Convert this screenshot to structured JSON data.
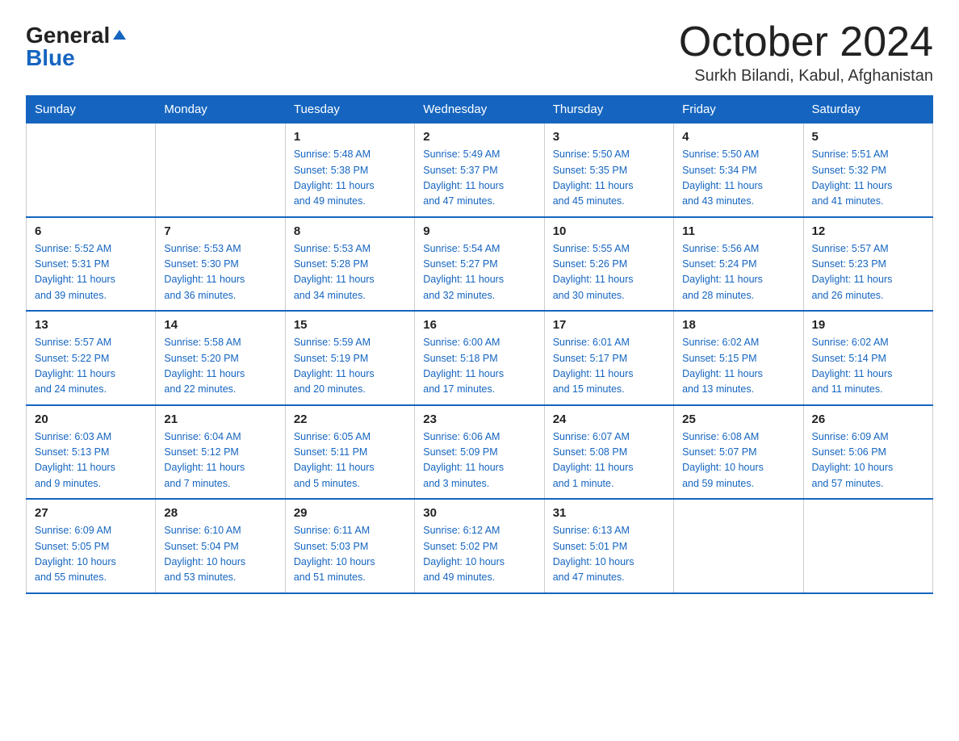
{
  "logo": {
    "line1": "General",
    "triangle": "▲",
    "line2": "Blue"
  },
  "title": "October 2024",
  "subtitle": "Surkh Bilandi, Kabul, Afghanistan",
  "days_of_week": [
    "Sunday",
    "Monday",
    "Tuesday",
    "Wednesday",
    "Thursday",
    "Friday",
    "Saturday"
  ],
  "weeks": [
    [
      {
        "day": "",
        "info": ""
      },
      {
        "day": "",
        "info": ""
      },
      {
        "day": "1",
        "info": "Sunrise: 5:48 AM\nSunset: 5:38 PM\nDaylight: 11 hours\nand 49 minutes."
      },
      {
        "day": "2",
        "info": "Sunrise: 5:49 AM\nSunset: 5:37 PM\nDaylight: 11 hours\nand 47 minutes."
      },
      {
        "day": "3",
        "info": "Sunrise: 5:50 AM\nSunset: 5:35 PM\nDaylight: 11 hours\nand 45 minutes."
      },
      {
        "day": "4",
        "info": "Sunrise: 5:50 AM\nSunset: 5:34 PM\nDaylight: 11 hours\nand 43 minutes."
      },
      {
        "day": "5",
        "info": "Sunrise: 5:51 AM\nSunset: 5:32 PM\nDaylight: 11 hours\nand 41 minutes."
      }
    ],
    [
      {
        "day": "6",
        "info": "Sunrise: 5:52 AM\nSunset: 5:31 PM\nDaylight: 11 hours\nand 39 minutes."
      },
      {
        "day": "7",
        "info": "Sunrise: 5:53 AM\nSunset: 5:30 PM\nDaylight: 11 hours\nand 36 minutes."
      },
      {
        "day": "8",
        "info": "Sunrise: 5:53 AM\nSunset: 5:28 PM\nDaylight: 11 hours\nand 34 minutes."
      },
      {
        "day": "9",
        "info": "Sunrise: 5:54 AM\nSunset: 5:27 PM\nDaylight: 11 hours\nand 32 minutes."
      },
      {
        "day": "10",
        "info": "Sunrise: 5:55 AM\nSunset: 5:26 PM\nDaylight: 11 hours\nand 30 minutes."
      },
      {
        "day": "11",
        "info": "Sunrise: 5:56 AM\nSunset: 5:24 PM\nDaylight: 11 hours\nand 28 minutes."
      },
      {
        "day": "12",
        "info": "Sunrise: 5:57 AM\nSunset: 5:23 PM\nDaylight: 11 hours\nand 26 minutes."
      }
    ],
    [
      {
        "day": "13",
        "info": "Sunrise: 5:57 AM\nSunset: 5:22 PM\nDaylight: 11 hours\nand 24 minutes."
      },
      {
        "day": "14",
        "info": "Sunrise: 5:58 AM\nSunset: 5:20 PM\nDaylight: 11 hours\nand 22 minutes."
      },
      {
        "day": "15",
        "info": "Sunrise: 5:59 AM\nSunset: 5:19 PM\nDaylight: 11 hours\nand 20 minutes."
      },
      {
        "day": "16",
        "info": "Sunrise: 6:00 AM\nSunset: 5:18 PM\nDaylight: 11 hours\nand 17 minutes."
      },
      {
        "day": "17",
        "info": "Sunrise: 6:01 AM\nSunset: 5:17 PM\nDaylight: 11 hours\nand 15 minutes."
      },
      {
        "day": "18",
        "info": "Sunrise: 6:02 AM\nSunset: 5:15 PM\nDaylight: 11 hours\nand 13 minutes."
      },
      {
        "day": "19",
        "info": "Sunrise: 6:02 AM\nSunset: 5:14 PM\nDaylight: 11 hours\nand 11 minutes."
      }
    ],
    [
      {
        "day": "20",
        "info": "Sunrise: 6:03 AM\nSunset: 5:13 PM\nDaylight: 11 hours\nand 9 minutes."
      },
      {
        "day": "21",
        "info": "Sunrise: 6:04 AM\nSunset: 5:12 PM\nDaylight: 11 hours\nand 7 minutes."
      },
      {
        "day": "22",
        "info": "Sunrise: 6:05 AM\nSunset: 5:11 PM\nDaylight: 11 hours\nand 5 minutes."
      },
      {
        "day": "23",
        "info": "Sunrise: 6:06 AM\nSunset: 5:09 PM\nDaylight: 11 hours\nand 3 minutes."
      },
      {
        "day": "24",
        "info": "Sunrise: 6:07 AM\nSunset: 5:08 PM\nDaylight: 11 hours\nand 1 minute."
      },
      {
        "day": "25",
        "info": "Sunrise: 6:08 AM\nSunset: 5:07 PM\nDaylight: 10 hours\nand 59 minutes."
      },
      {
        "day": "26",
        "info": "Sunrise: 6:09 AM\nSunset: 5:06 PM\nDaylight: 10 hours\nand 57 minutes."
      }
    ],
    [
      {
        "day": "27",
        "info": "Sunrise: 6:09 AM\nSunset: 5:05 PM\nDaylight: 10 hours\nand 55 minutes."
      },
      {
        "day": "28",
        "info": "Sunrise: 6:10 AM\nSunset: 5:04 PM\nDaylight: 10 hours\nand 53 minutes."
      },
      {
        "day": "29",
        "info": "Sunrise: 6:11 AM\nSunset: 5:03 PM\nDaylight: 10 hours\nand 51 minutes."
      },
      {
        "day": "30",
        "info": "Sunrise: 6:12 AM\nSunset: 5:02 PM\nDaylight: 10 hours\nand 49 minutes."
      },
      {
        "day": "31",
        "info": "Sunrise: 6:13 AM\nSunset: 5:01 PM\nDaylight: 10 hours\nand 47 minutes."
      },
      {
        "day": "",
        "info": ""
      },
      {
        "day": "",
        "info": ""
      }
    ]
  ],
  "colors": {
    "header_bg": "#1565c0",
    "header_text": "#ffffff",
    "border": "#1565c0",
    "cell_border": "#cccccc",
    "info_text": "#1565c0"
  }
}
